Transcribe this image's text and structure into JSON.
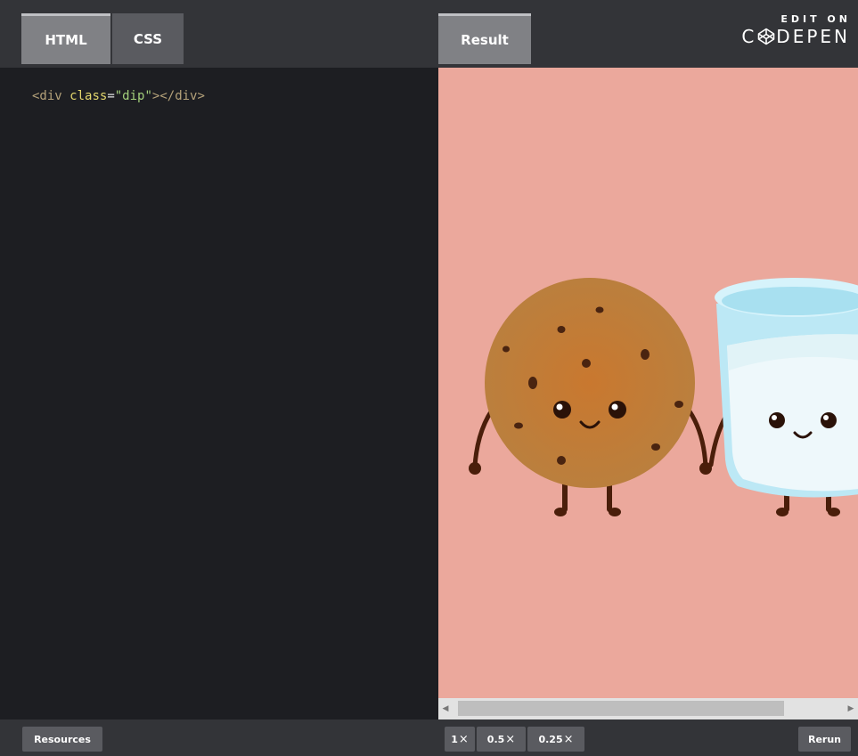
{
  "tabs": {
    "html": "HTML",
    "css": "CSS",
    "result": "Result"
  },
  "branding": {
    "edit_on": "EDIT ON",
    "brand_c": "C",
    "brand_rest": "DEPEN"
  },
  "code": {
    "open": "<div ",
    "attr": "class",
    "eq": "=",
    "value": "\"dip\"",
    "close": "></div>"
  },
  "bottom": {
    "resources": "Resources",
    "zoom": [
      {
        "num": "1",
        "x": "×"
      },
      {
        "num": "0.5",
        "x": "×"
      },
      {
        "num": "0.25",
        "x": "×"
      }
    ],
    "rerun": "Rerun"
  },
  "colors": {
    "result_bg": "#eba89c",
    "cookie": "#c27d3a",
    "chip": "#4a2410",
    "milk": "#eef8fb",
    "glass": "#bce8f5"
  }
}
